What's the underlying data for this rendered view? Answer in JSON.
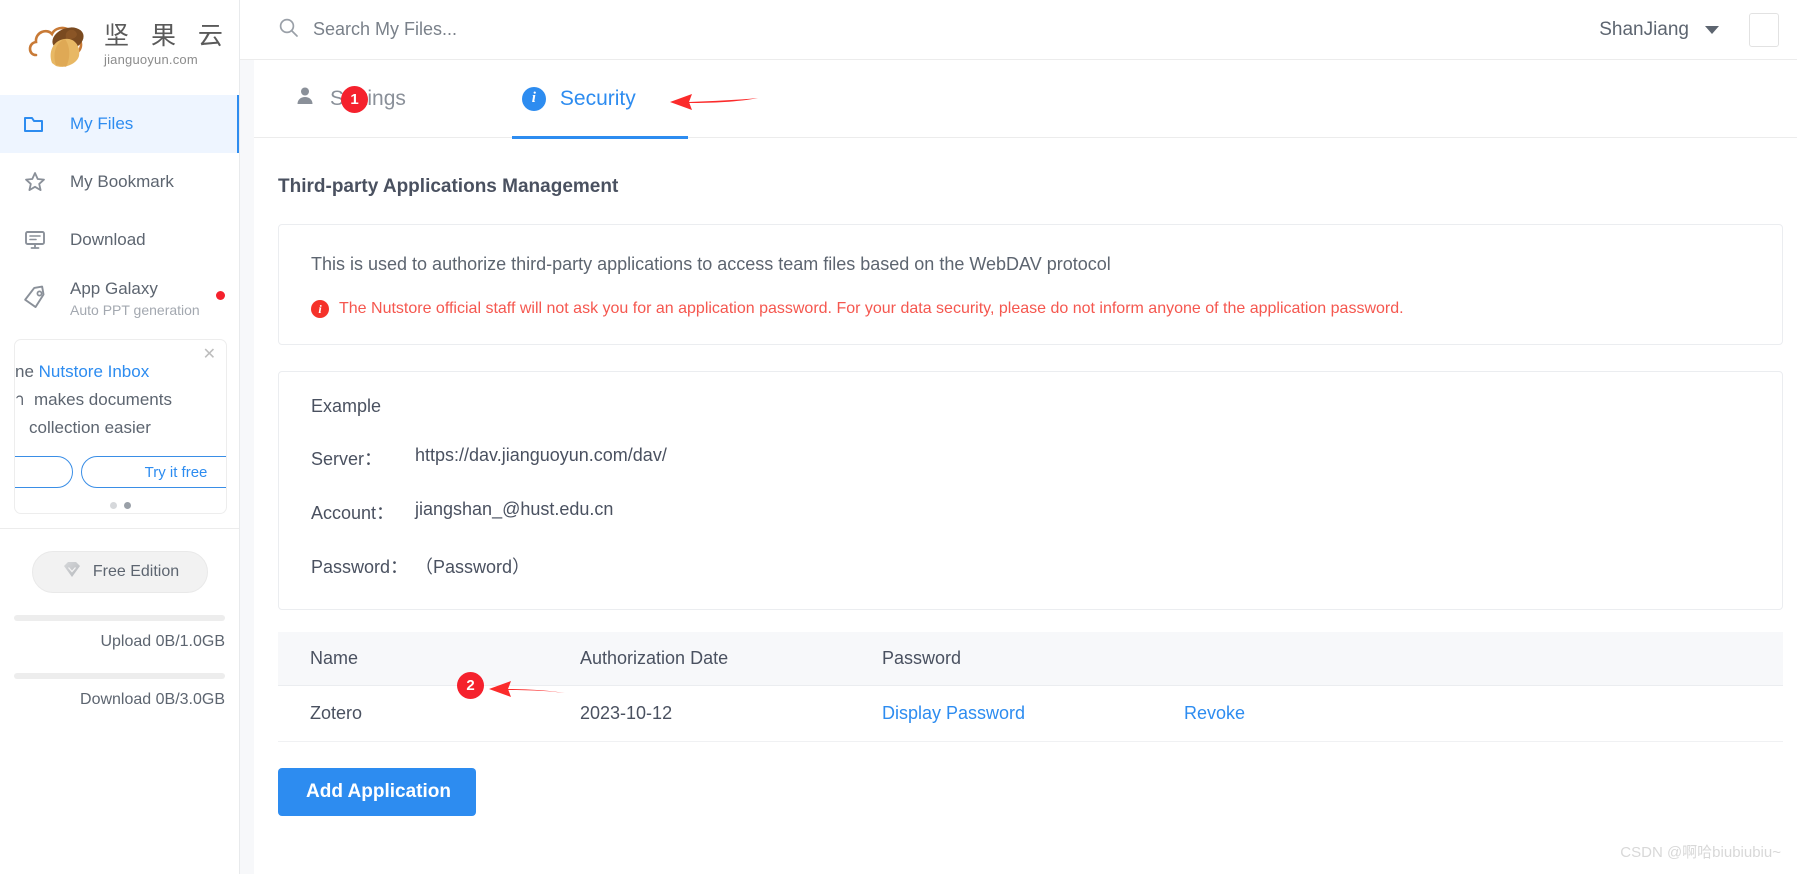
{
  "brand": {
    "name_cn": "坚 果 云",
    "domain": "jianguoyun.com",
    "logo_icon": "acorn-cloud-logo"
  },
  "sidebar": {
    "items": [
      {
        "label": "My Files",
        "icon": "folder-icon",
        "active": true
      },
      {
        "label": "My Bookmark",
        "icon": "star-icon",
        "active": false
      },
      {
        "label": "Download",
        "icon": "monitor-icon",
        "active": false
      },
      {
        "label": "App Galaxy",
        "sub": "Auto PPT generation",
        "icon": "tag-icon",
        "active": false,
        "badge_dot": true
      }
    ],
    "promo": {
      "close_icon": "close-icon",
      "line1_prefix": "ne",
      "line1_link": "Nutstore Inbox",
      "line2_prefix": "า",
      "line2_text": "makes documents",
      "line3_text": "collection easier",
      "button_partial": "",
      "button_label": "Try it free",
      "dots": 2,
      "active_dot": 1
    },
    "plan": {
      "chip_label": "Free Edition",
      "chip_icon": "diamond-icon",
      "upload_label": "Upload 0B/1.0GB",
      "download_label": "Download 0B/3.0GB"
    }
  },
  "topbar": {
    "search_placeholder": "Search My Files...",
    "search_value": "",
    "search_icon": "search-icon",
    "user_name": "ShanJiang",
    "caret_icon": "chevron-down-icon"
  },
  "tabs": [
    {
      "label": "Settings",
      "icon": "person-icon",
      "active": false
    },
    {
      "label": "Security",
      "icon": "info-icon",
      "active": true
    }
  ],
  "annotations": {
    "step1": "1",
    "step2": "2",
    "arrow_icon": "arrow-left-icon"
  },
  "main": {
    "section_title": "Third-party Applications Management",
    "description": "This is used to authorize third-party applications to access team files based on the WebDAV protocol",
    "warning_icon": "info-circle-icon",
    "warning": "The Nutstore official staff will not ask you for an application password. For your data security, please do not inform anyone of the application password.",
    "example": {
      "title": "Example",
      "rows": [
        {
          "key": "Server：",
          "value": "https://dav.jianguoyun.com/dav/"
        },
        {
          "key": "Account：",
          "value": "jiangshan_@hust.edu.cn"
        },
        {
          "key": "Password：",
          "value": "（Password）"
        }
      ]
    },
    "table": {
      "headers": [
        "Name",
        "Authorization Date",
        "Password",
        ""
      ],
      "rows": [
        {
          "name": "Zotero",
          "date": "2023-10-12",
          "password_link": "Display Password",
          "action_link": "Revoke"
        }
      ]
    },
    "add_button": "Add Application"
  },
  "watermark": "CSDN @啊哈biubiubiu~",
  "colors": {
    "accent": "#2d8cf0",
    "danger": "#f5212d",
    "warning_text": "#f5574f",
    "sidebar_active_bg": "#eef5ff",
    "page_bg": "#f7f8fa",
    "text": "#4a5160"
  }
}
